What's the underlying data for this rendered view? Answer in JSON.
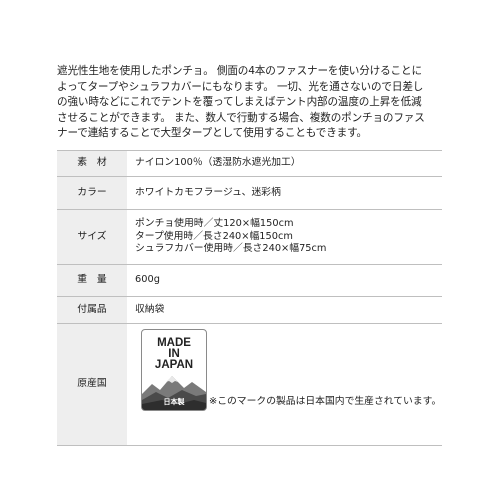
{
  "description": {
    "lines": [
      "遮光性生地を使用したポンチョ。 側面の4本のファスナーを使い分けることに",
      "よってタープやシュラフカバーにもなります。 一切、光を通さないので日差し",
      "の強い時などにこれでテントを覆ってしまえばテント内部の温度の上昇を低減",
      "させることができます。 また、数人で行動する場合、複数のポンチョのファス",
      "ナーで連結することで大型タープとして使用することもできます。"
    ]
  },
  "spec": {
    "material": {
      "label": "素　材",
      "value": "ナイロン100％（透湿防水遮光加工）"
    },
    "color": {
      "label": "カラー",
      "value": "ホワイトカモフラージュ、迷彩柄"
    },
    "size": {
      "label": "サイズ",
      "lines": [
        "ポンチョ使用時／丈120×幅150cm",
        "タープ使用時／長さ240×幅150cm",
        "シュラフカバー使用時／長さ240×幅75cm"
      ]
    },
    "weight": {
      "label": "重　量",
      "value": "600g"
    },
    "accessories": {
      "label": "付属品",
      "value": "収納袋"
    },
    "origin": {
      "label": "原産国",
      "badge": {
        "line1": "MADE",
        "line2": "IN",
        "line3": "JAPAN",
        "bottom": "日本製"
      },
      "note": "※このマークの製品は日本国内で生産されています。"
    }
  }
}
